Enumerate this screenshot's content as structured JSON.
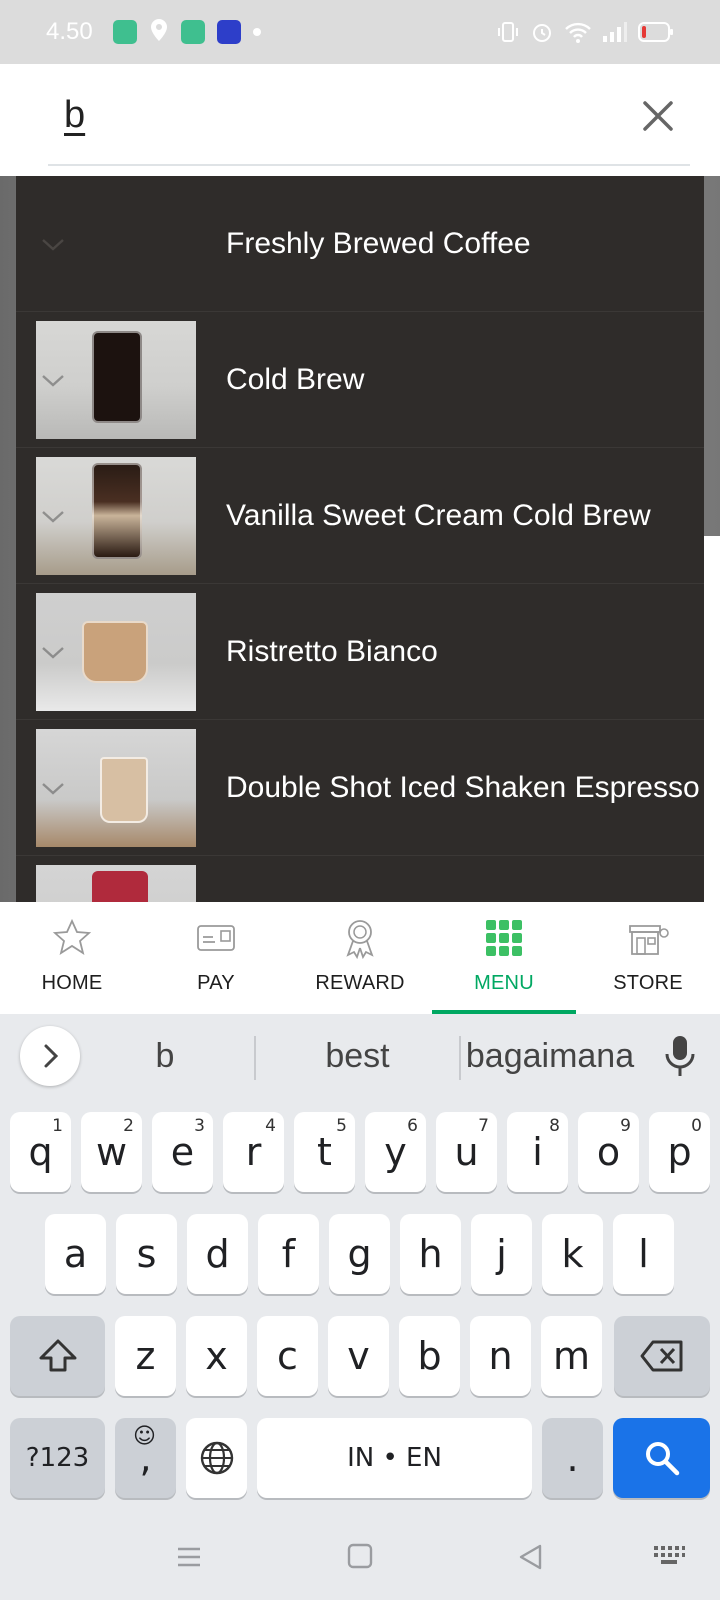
{
  "status_bar": {
    "time": "4.50",
    "battery_color": "#e53935"
  },
  "search": {
    "query": "b",
    "clear_icon": "close-icon"
  },
  "results": [
    {
      "name": "Freshly Brewed Coffee",
      "has_image": false,
      "image_tint": ""
    },
    {
      "name": "Cold Brew",
      "has_image": true,
      "image_tint": "cold-brew"
    },
    {
      "name": "Vanilla Sweet Cream Cold Brew",
      "has_image": true,
      "image_tint": "vanilla-cold-brew"
    },
    {
      "name": "Ristretto Bianco",
      "has_image": true,
      "image_tint": "ristretto"
    },
    {
      "name": "Double Shot Iced Shaken Espresso",
      "has_image": true,
      "image_tint": "double-shot"
    },
    {
      "name": "",
      "has_image": true,
      "image_tint": "red-drink"
    }
  ],
  "bottom_nav": {
    "items": [
      {
        "label": "HOME",
        "icon": "star-icon"
      },
      {
        "label": "PAY",
        "icon": "card-icon"
      },
      {
        "label": "REWARD",
        "icon": "award-icon"
      },
      {
        "label": "MENU",
        "icon": "grid-icon"
      },
      {
        "label": "STORE",
        "icon": "store-icon"
      }
    ],
    "active": "MENU",
    "accent": "#00a862"
  },
  "keyboard": {
    "suggestions": [
      "b",
      "best",
      "bagaimana"
    ],
    "row1": [
      [
        "q",
        "1"
      ],
      [
        "w",
        "2"
      ],
      [
        "e",
        "3"
      ],
      [
        "r",
        "4"
      ],
      [
        "t",
        "5"
      ],
      [
        "y",
        "6"
      ],
      [
        "u",
        "7"
      ],
      [
        "i",
        "8"
      ],
      [
        "o",
        "9"
      ],
      [
        "p",
        "0"
      ]
    ],
    "row2": [
      "a",
      "s",
      "d",
      "f",
      "g",
      "h",
      "j",
      "k",
      "l"
    ],
    "row3": [
      "z",
      "x",
      "c",
      "v",
      "b",
      "n",
      "m"
    ],
    "symbols_label": "?123",
    "comma_label": ",",
    "space_label": "IN • EN",
    "period_label": ".",
    "search_key_color": "#1a73e8"
  }
}
